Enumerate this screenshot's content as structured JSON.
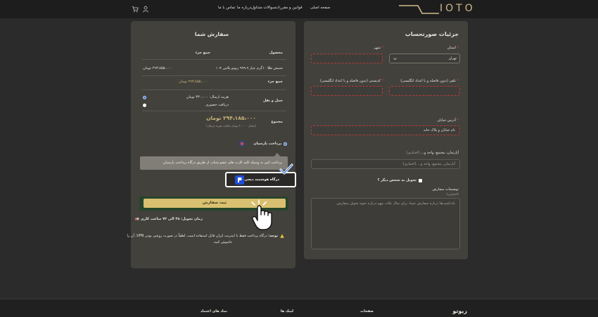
{
  "header": {
    "logo_text": "IOTO",
    "nav": [
      "صفحه اصلی",
      "قوانین و مقررات",
      "سوالات متداول",
      "درباره ما",
      "تماس با ما"
    ],
    "icons": [
      "user-icon",
      "cart-icon"
    ]
  },
  "billing": {
    "title": "جزئیات صورتحساب",
    "province_label": "استان",
    "province_value": "تهران",
    "city_label": "شهر",
    "phone_label": "تلفن (بدون فاصله و با اعداد انگلیسی)",
    "postal_label": "کدپستی (بدون فاصله و با اعداد انگلیسی)",
    "address_label": "آدرس خیابان",
    "address_placeholder": "نام خیابان و پلاک خانه",
    "unit_label": "آپارتمان، مجتمع، واحد و...",
    "unit_optional": "(اختیاری)",
    "unit_placeholder": "آپارتمان، مجتمع، واحد و... (اختیاری)",
    "ship_other_label": "تحویل به شخص دیگر ؟",
    "notes_label": "توضیحات سفارش",
    "notes_optional": "(اختیاری)",
    "notes_placeholder": "یادداشت‌ها درباره سفارش شما، برای مثال نکات مهم درباره نحوه تحویل سفارش."
  },
  "order": {
    "title": "سفارش شما",
    "col_product": "محصول",
    "col_subtotal": "جمع جزء",
    "item_name": "شمش طلا ۱۰گرم عیار ۹۹۹،۹ زیوتو پلاس × ۱",
    "item_price": "۲۹۳،۸۵۵،۰۰۰ تومان",
    "subtotal_label": "جمع جزء",
    "subtotal_value": "۲۹۳،۸۵۵،۰۰۰ تومان",
    "shipping_label": "حمل و نقل",
    "shipping_opt1": "هزینه ارسال: ۳۳۰،۰۰۰ تومان",
    "shipping_opt2": "دریافت حضوری",
    "total_label": "مجموع",
    "total_value": "۲۹۴،۱۸۵،۰۰۰ تومان",
    "total_note": "(شامل ۳۰،۰۰۰ تومان مالیات هزینه ارسال)",
    "payment_method": "پرداخت پارسیان",
    "payment_desc": "پرداخت امن به وسیله کلیه کارت های عضو شتاب از طریق درگاه پرداخت پارسیان",
    "gateway_label": "درگاه هوشمند دیجی‌پی",
    "submit_label": "ثبت سفارش",
    "delivery_note": "زمان تحویل: ۴۸ الی ۷۲ ساعت کاری",
    "warning_bold": "توجه:",
    "warning_text1": "درگاه پرداخت فقط با اینترنت ایران قابل استفاده است. لطفاً در صورت روشن بودن VPN، آن را",
    "warning_text2": "خاموش کنید."
  },
  "footer": {
    "brand": "زیوتو",
    "pages": "صفحات",
    "links": "لینک ها",
    "trust": "نماد های اعتماد"
  },
  "colors": {
    "background": "#2b2b2b",
    "panel": "#43413c",
    "gold": "#d9c071",
    "required": "#d24b4b"
  }
}
